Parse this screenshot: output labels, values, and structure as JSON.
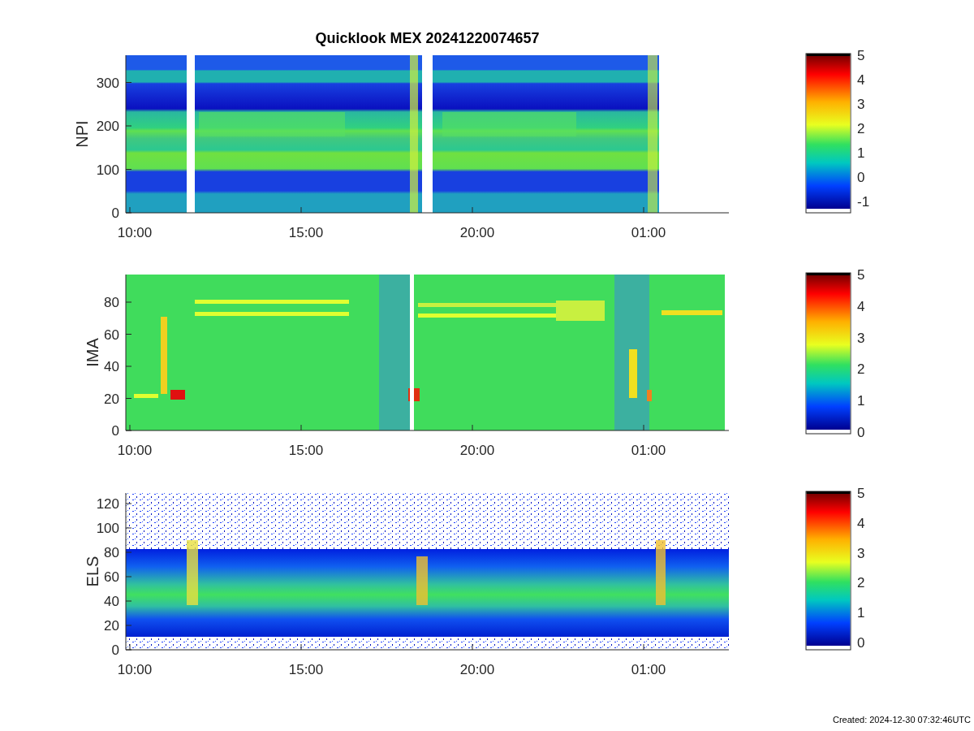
{
  "title": "Quicklook MEX 20241220074657",
  "panels": [
    {
      "kind": "npi",
      "ylabel": "NPI",
      "yticks": [
        "300",
        "200",
        "100",
        "0"
      ],
      "xticks": [
        "10:00",
        "15:00",
        "20:00",
        "01:00"
      ],
      "colorbar_ticks": [
        "5",
        "4",
        "3",
        "2",
        "1",
        "0",
        "-1"
      ]
    },
    {
      "kind": "ima",
      "ylabel": "IMA",
      "yticks": [
        "80",
        "60",
        "40",
        "20",
        "0"
      ],
      "xticks": [
        "10:00",
        "15:00",
        "20:00",
        "01:00"
      ],
      "colorbar_ticks": [
        "5",
        "4",
        "3",
        "2",
        "1",
        "0"
      ]
    },
    {
      "kind": "els",
      "ylabel": "ELS",
      "yticks": [
        "120",
        "100",
        "80",
        "60",
        "40",
        "20",
        "0"
      ],
      "xticks": [
        "10:00",
        "15:00",
        "20:00",
        "01:00"
      ],
      "colorbar_ticks": [
        "5",
        "4",
        "3",
        "2",
        "1",
        "0"
      ]
    }
  ],
  "footer": "Created: 2024-12-30 07:32:46UTC"
}
